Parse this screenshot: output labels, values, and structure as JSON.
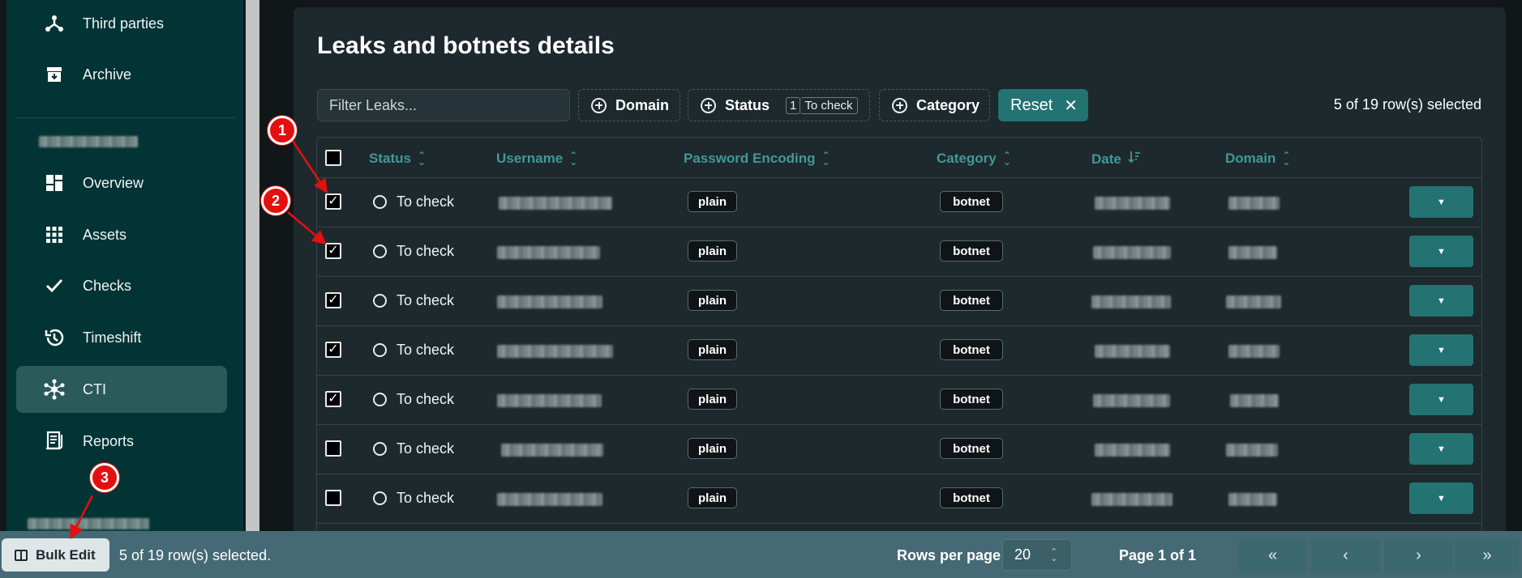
{
  "sidebar": {
    "items": [
      {
        "label": "Third parties",
        "icon": "third-parties-icon"
      },
      {
        "label": "Archive",
        "icon": "archive-icon"
      },
      {
        "label": "Overview",
        "icon": "overview-icon"
      },
      {
        "label": "Assets",
        "icon": "assets-icon"
      },
      {
        "label": "Checks",
        "icon": "checks-icon"
      },
      {
        "label": "Timeshift",
        "icon": "timeshift-icon"
      },
      {
        "label": "CTI",
        "icon": "cti-icon"
      },
      {
        "label": "Reports",
        "icon": "reports-icon"
      }
    ],
    "active": "CTI"
  },
  "page": {
    "title": "Leaks and botnets details"
  },
  "toolbar": {
    "filter_placeholder": "Filter Leaks...",
    "domain_label": "Domain",
    "status_label": "Status",
    "status_count": "1",
    "status_value": "To check",
    "category_label": "Category",
    "reset_label": "Reset",
    "reset_icon": "close-icon",
    "selected_text": "5 of 19 row(s) selected"
  },
  "table": {
    "headers": [
      "Status",
      "Username",
      "Password Encoding",
      "Category",
      "Date",
      "Domain"
    ],
    "rows": [
      {
        "checked": true,
        "status": "To check",
        "encoding": "plain",
        "category": "botnet"
      },
      {
        "checked": true,
        "status": "To check",
        "encoding": "plain",
        "category": "botnet"
      },
      {
        "checked": true,
        "status": "To check",
        "encoding": "plain",
        "category": "botnet"
      },
      {
        "checked": true,
        "status": "To check",
        "encoding": "plain",
        "category": "botnet"
      },
      {
        "checked": true,
        "status": "To check",
        "encoding": "plain",
        "category": "botnet"
      },
      {
        "checked": false,
        "status": "To check",
        "encoding": "plain",
        "category": "botnet"
      },
      {
        "checked": false,
        "status": "To check",
        "encoding": "plain",
        "category": "botnet"
      }
    ]
  },
  "footer": {
    "bulk_edit_label": "Bulk Edit",
    "selected_text": "5 of 19 row(s) selected.",
    "rows_per_page_label": "Rows per page",
    "rows_per_page_value": "20",
    "page_text": "Page 1 of 1",
    "first_label": "«",
    "prev_label": "‹",
    "next_label": "›",
    "last_label": "»"
  },
  "annotations": [
    "1",
    "2",
    "3"
  ],
  "colors": {
    "sidebar_bg": "#023435",
    "accent": "#237373",
    "annotation": "#e31010"
  }
}
